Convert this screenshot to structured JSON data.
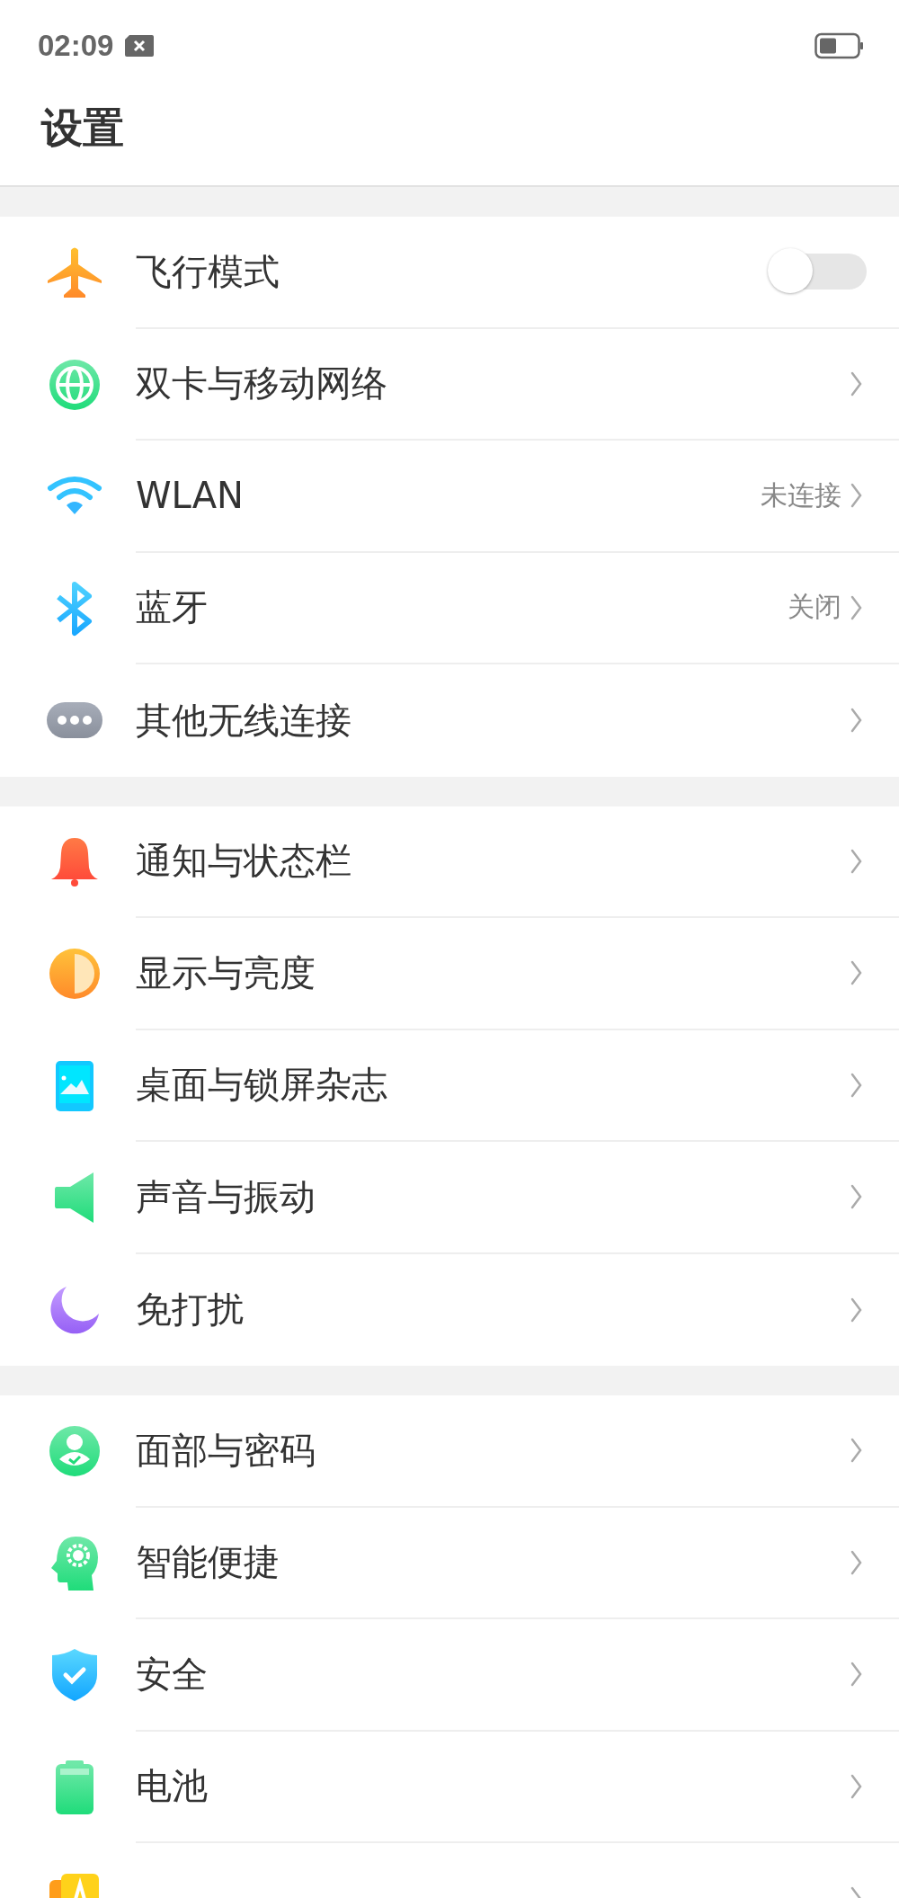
{
  "status_bar": {
    "time": "02:09"
  },
  "title": "设置",
  "groups": [
    {
      "items": [
        {
          "kind": "toggle",
          "label": "飞行模式",
          "on": false
        },
        {
          "kind": "link",
          "label": "双卡与移动网络"
        },
        {
          "kind": "link",
          "label": "WLAN",
          "value": "未连接"
        },
        {
          "kind": "link",
          "label": "蓝牙",
          "value": "关闭"
        },
        {
          "kind": "link",
          "label": "其他无线连接"
        }
      ]
    },
    {
      "items": [
        {
          "kind": "link",
          "label": "通知与状态栏"
        },
        {
          "kind": "link",
          "label": "显示与亮度"
        },
        {
          "kind": "link",
          "label": "桌面与锁屏杂志"
        },
        {
          "kind": "link",
          "label": "声音与振动"
        },
        {
          "kind": "link",
          "label": "免打扰"
        }
      ]
    },
    {
      "items": [
        {
          "kind": "link",
          "label": "面部与密码"
        },
        {
          "kind": "link",
          "label": "智能便捷"
        },
        {
          "kind": "link",
          "label": "安全"
        },
        {
          "kind": "link",
          "label": "电池"
        },
        {
          "kind": "link"
        }
      ]
    }
  ]
}
